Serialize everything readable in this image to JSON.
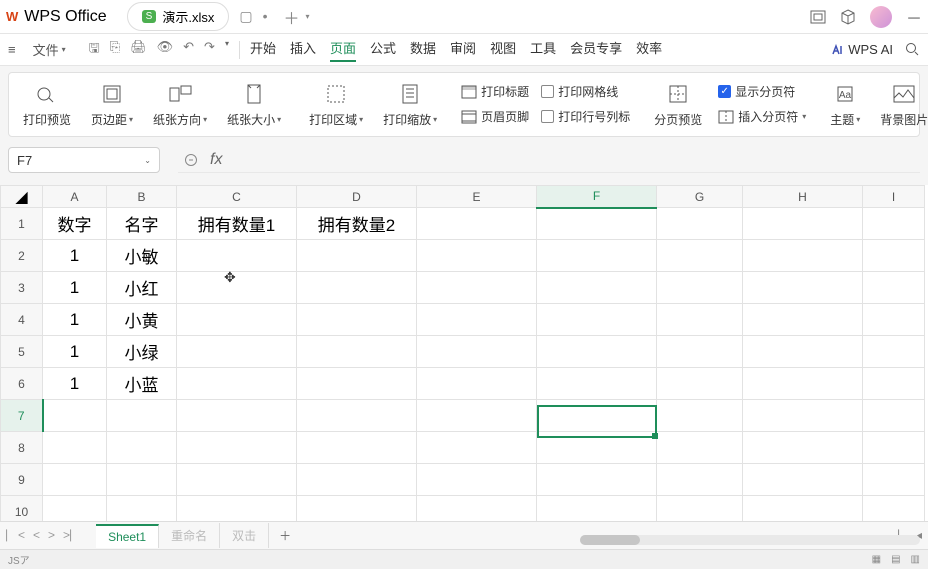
{
  "titlebar": {
    "app_name": "WPS Office",
    "tab_badge": "S",
    "tab_name": "演示.xlsx"
  },
  "menubar": {
    "file": "文件",
    "tabs": [
      "开始",
      "插入",
      "页面",
      "公式",
      "数据",
      "审阅",
      "视图",
      "工具",
      "会员专享",
      "效率"
    ],
    "active_index": 2,
    "wps_ai": "WPS AI"
  },
  "ribbon": {
    "print_preview": "打印预览",
    "margin": "页边距",
    "orientation": "纸张方向",
    "size": "纸张大小",
    "print_area": "打印区域",
    "print_scale": "打印缩放",
    "print_title": "打印标题",
    "header_footer": "页眉页脚",
    "print_gridlines": "打印网格线",
    "print_rowcol": "打印行号列标",
    "pagebreak_preview": "分页预览",
    "insert_break": "插入分页符",
    "show_break": "显示分页符",
    "theme": "主题",
    "background": "背景图片"
  },
  "formula": {
    "cell_ref": "F7",
    "fx": "fx"
  },
  "grid": {
    "columns": [
      "A",
      "B",
      "C",
      "D",
      "E",
      "F",
      "G",
      "H",
      "I"
    ],
    "rows": [
      "1",
      "2",
      "3",
      "4",
      "5",
      "6",
      "7",
      "8",
      "9",
      "10"
    ],
    "data": {
      "A1": "数字",
      "B1": "名字",
      "C1": "拥有数量1",
      "D1": "拥有数量2",
      "A2": "1",
      "B2": "小敏",
      "A3": "1",
      "B3": "小红",
      "A4": "1",
      "B4": "小黄",
      "A5": "1",
      "B5": "小绿",
      "A6": "1",
      "B6": "小蓝"
    },
    "selected_col": "F",
    "selected_row": "7"
  },
  "tabs": {
    "sheets": [
      "Sheet1"
    ],
    "ghost1": "重命名",
    "ghost2": "双击"
  },
  "status": {
    "left": "JSア"
  }
}
